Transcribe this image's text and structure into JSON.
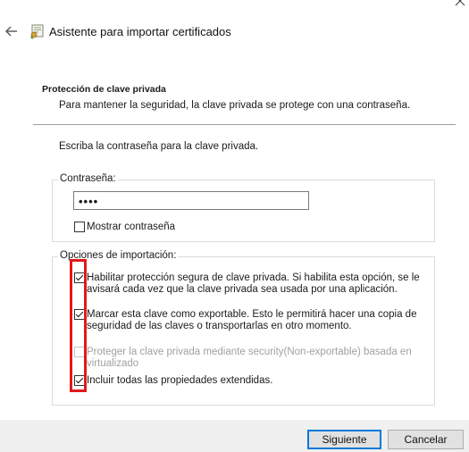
{
  "window": {
    "title": "Asistente para importar certificados",
    "icons": {
      "back": "back-arrow-icon",
      "app": "certificate-icon",
      "close": "close-icon"
    }
  },
  "section": {
    "title": "Protección de clave privada",
    "description": "Para mantener la seguridad, la clave privada se protege con una contraseña."
  },
  "instruction": "Escriba la contraseña para la clave privada.",
  "password_group": {
    "label": "Contraseña:",
    "value": "••••",
    "show_password_label": "Mostrar contraseña",
    "show_password_checked": false
  },
  "import_options": {
    "label": "Opciones de importación:",
    "options": [
      {
        "line1": "Habilitar protección segura de clave privada. Si habilita esta opción, se le",
        "line2": "avisará cada vez que la clave privada sea usada por una aplicación.",
        "checked": true,
        "enabled": true
      },
      {
        "line1": "Marcar esta clave como exportable. Esto le permitirá hacer una copia de",
        "line2": "seguridad de las claves o transportarlas en otro momento.",
        "checked": true,
        "enabled": true
      },
      {
        "line1": "Proteger la clave privada mediante security(Non-exportable) basada en",
        "line2": "virtualizado",
        "checked": false,
        "enabled": false
      },
      {
        "line1": "Incluir todas las propiedades extendidas.",
        "line2": "",
        "checked": true,
        "enabled": true
      }
    ]
  },
  "highlight_color": "#e01a1a",
  "buttons": {
    "next": "Siguiente",
    "cancel": "Cancelar"
  }
}
